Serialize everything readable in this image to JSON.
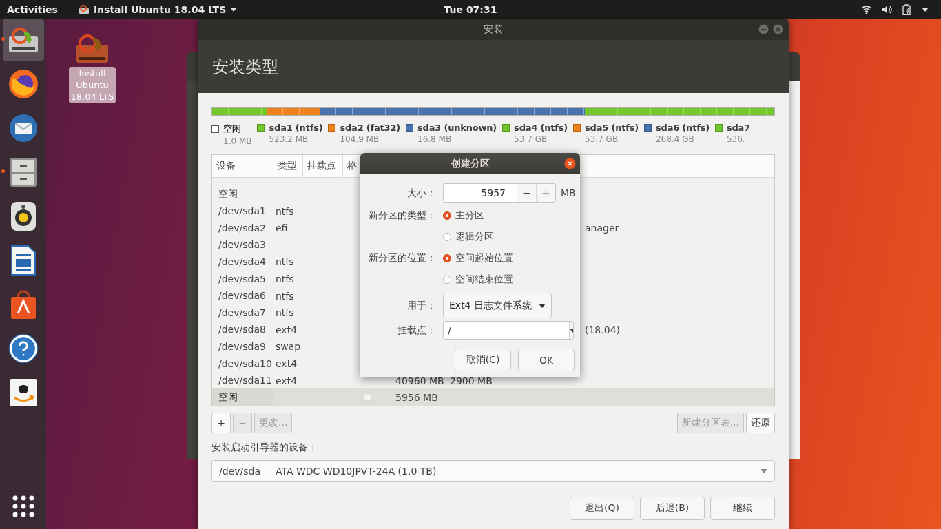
{
  "top_bar": {
    "activities": "Activities",
    "app_menu": "Install Ubuntu 18.04 LTS",
    "clock": "Tue 07:31"
  },
  "dock": {
    "items": [
      {
        "kind": "installer",
        "selected": true,
        "running": true
      },
      {
        "kind": "firefox",
        "selected": false,
        "running": false
      },
      {
        "kind": "thunderbird",
        "selected": false,
        "running": false
      },
      {
        "kind": "files",
        "selected": false,
        "running": true
      },
      {
        "kind": "rhythmbox",
        "selected": false,
        "running": false
      },
      {
        "kind": "writer",
        "selected": false,
        "running": false
      },
      {
        "kind": "software",
        "selected": false,
        "running": false
      },
      {
        "kind": "help",
        "selected": false,
        "running": false
      },
      {
        "kind": "amazon",
        "selected": false,
        "running": false
      }
    ]
  },
  "desktop_icons": [
    {
      "label": "Install Ubuntu 18.04 LTS",
      "selected": true
    }
  ],
  "window": {
    "title": "安装",
    "heading": "安装类型",
    "disk_bar": [
      {
        "color": "#73c72a",
        "level": 0.097
      },
      {
        "color": "#f0821e",
        "level": 0.094
      },
      {
        "color": "#4a72ad",
        "level": 0.472
      },
      {
        "color": "#73c72a",
        "level": 0.337
      }
    ],
    "legend": [
      {
        "kind": "free",
        "label": "空闲",
        "size": "1.0 MB"
      },
      {
        "kind": "partition",
        "label": "sda1 (ntfs)",
        "size": "523.2 MB",
        "color": "#73c72a"
      },
      {
        "kind": "partition",
        "label": "sda2 (fat32)",
        "size": "104.9 MB",
        "color": "#f0821e"
      },
      {
        "kind": "partition",
        "label": "sda3 (unknown)",
        "size": "16.8 MB",
        "color": "#4a72ad"
      },
      {
        "kind": "partition",
        "label": "sda4 (ntfs)",
        "size": "53.7 GB",
        "color": "#73c72a"
      },
      {
        "kind": "partition",
        "label": "sda5 (ntfs)",
        "size": "53.7 GB",
        "color": "#f0821e"
      },
      {
        "kind": "partition",
        "label": "sda6 (ntfs)",
        "size": "268.4 GB",
        "color": "#4a72ad"
      },
      {
        "kind": "partition",
        "label": "sda7",
        "size": "536.",
        "color": "#73c72a"
      }
    ],
    "table": {
      "columns": [
        "设备",
        "类型",
        "挂载点",
        "格"
      ],
      "rows": [
        {
          "device": "空闲",
          "selected": false
        },
        {
          "device": "/dev/sda1",
          "type": "ntfs",
          "selected": false
        },
        {
          "device": "/dev/sda2",
          "type": "efi",
          "column_7": "anager",
          "selected": false
        },
        {
          "device": "/dev/sda3",
          "selected": false
        },
        {
          "device": "/dev/sda4",
          "type": "ntfs",
          "selected": false
        },
        {
          "device": "/dev/sda5",
          "type": "ntfs",
          "selected": false
        },
        {
          "device": "/dev/sda6",
          "type": "ntfs",
          "selected": false
        },
        {
          "device": "/dev/sda7",
          "type": "ntfs",
          "selected": false
        },
        {
          "device": "/dev/sda8",
          "type": "ext4",
          "column_7": "(18.04)",
          "selected": false
        },
        {
          "device": "/dev/sda9",
          "type": "swap",
          "selected": false
        },
        {
          "device": "/dev/sda10",
          "type": "ext4",
          "selected": false
        },
        {
          "device": "/dev/sda11",
          "type": "ext4",
          "format": {
            "checked": false
          },
          "size": "40960 MB",
          "used": "2900 MB",
          "selected": false
        },
        {
          "device": "空闲",
          "format": {
            "checked": false
          },
          "size": "5956 MB",
          "selected": true
        }
      ]
    },
    "table_buttons": [
      {
        "label": "+",
        "disabled": false
      },
      {
        "label": "−",
        "disabled": true
      },
      {
        "label": "更改...",
        "disabled": true
      }
    ],
    "table_buttons_right": [
      {
        "label": "新建分区表...",
        "disabled": true
      },
      {
        "label": "还原",
        "disabled": false
      }
    ],
    "boot_label": "安装启动引导器的设备：",
    "boot_device": {
      "device": "/dev/sda",
      "description": "ATA WDC WD10JPVT-24A (1.0 TB)"
    },
    "nav_buttons": [
      {
        "label": "退出(Q)"
      },
      {
        "label": "后退(B)"
      },
      {
        "label": "继续"
      }
    ]
  },
  "dialog": {
    "title": "创建分区",
    "size_label": "大小：",
    "size_value": "5957",
    "size_unit": "MB",
    "size_buttons": [
      {
        "label": "−",
        "disabled": false
      },
      {
        "label": "+",
        "disabled": true
      }
    ],
    "type_label": "新分区的类型：",
    "type_options": [
      {
        "label": "主分区",
        "selected": true
      },
      {
        "label": "逻辑分区",
        "selected": false
      }
    ],
    "location_label": "新分区的位置：",
    "location_options": [
      {
        "label": "空间起始位置",
        "selected": true
      },
      {
        "label": "空间结束位置",
        "selected": false
      }
    ],
    "use_label": "用于：",
    "use_value": "Ext4 日志文件系统",
    "mount_label": "挂载点：",
    "mount_value": "/",
    "buttons": [
      {
        "label": "取消(C)"
      },
      {
        "label": "OK"
      }
    ]
  }
}
